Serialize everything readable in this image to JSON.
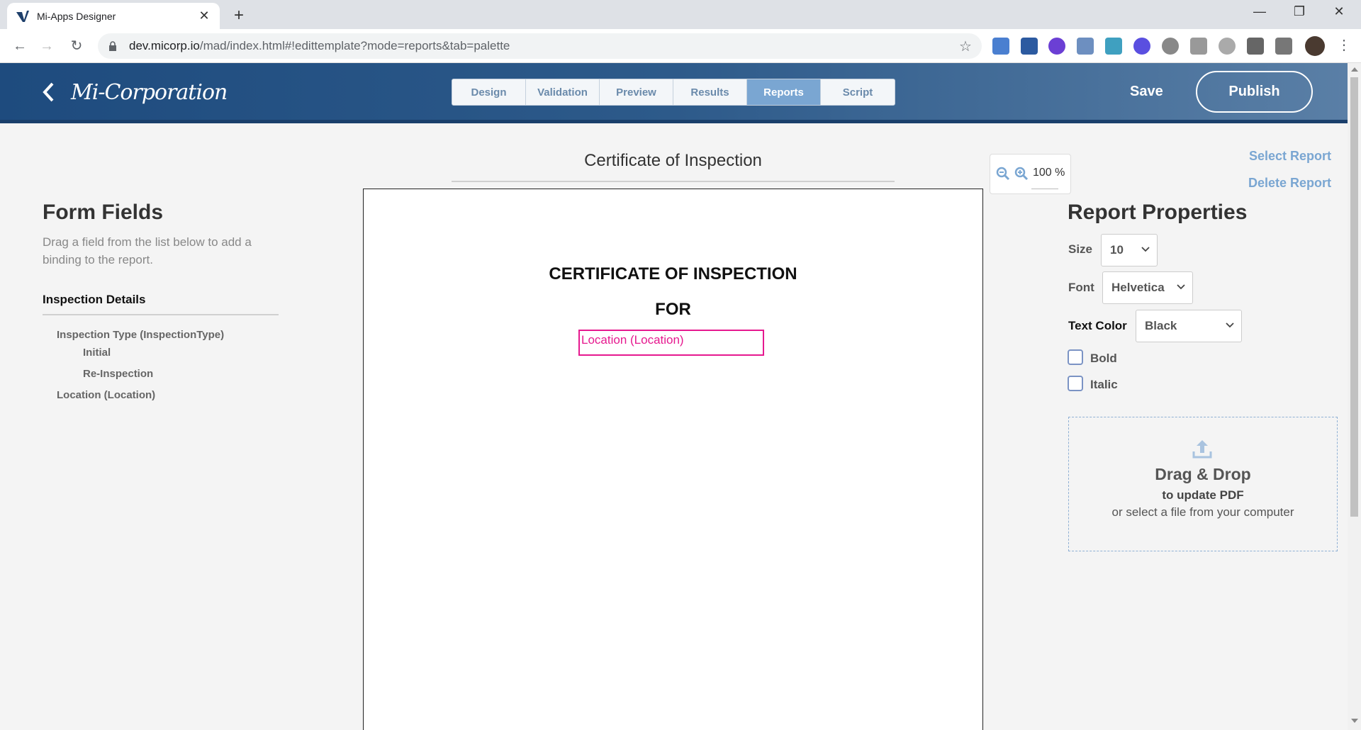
{
  "browser": {
    "tab_title": "Mi-Apps Designer",
    "url_host": "dev.micorp.io",
    "url_path": "/mad/index.html#!edittemplate?mode=reports&tab=palette"
  },
  "header": {
    "logo": "Mi-Corporation",
    "tabs": [
      "Design",
      "Validation",
      "Preview",
      "Results",
      "Reports",
      "Script"
    ],
    "active_tab": "Reports",
    "save_label": "Save",
    "publish_label": "Publish"
  },
  "form_fields": {
    "title": "Form Fields",
    "description": "Drag a field from the list below to add a binding to the report.",
    "section": "Inspection Details",
    "fields": {
      "inspection_type": "Inspection Type (InspectionType)",
      "initial": "Initial",
      "reinspection": "Re-Inspection",
      "location": "Location (Location)"
    }
  },
  "canvas": {
    "doc_title": "Certificate of Inspection",
    "heading_line1": "CERTIFICATE OF INSPECTION",
    "heading_line2": "FOR",
    "binding_label": "Location (Location)"
  },
  "zoom": {
    "value": "100 %"
  },
  "report_properties": {
    "select_report": "Select Report",
    "delete_report": "Delete Report",
    "title": "Report Properties",
    "size_label": "Size",
    "size_value": "10",
    "font_label": "Font",
    "font_value": "Helvetica",
    "color_label": "Text Color",
    "color_value": "Black",
    "bold_label": "Bold",
    "italic_label": "Italic",
    "dropzone": {
      "title": "Drag & Drop",
      "subtitle": "to update PDF",
      "hint": "or select a file from your computer"
    }
  },
  "colors": {
    "header_blue": "#1e4b7e",
    "active_tab": "#7aa6d2",
    "binding_magenta": "#e6198f",
    "link_blue": "#7aa6d2"
  }
}
